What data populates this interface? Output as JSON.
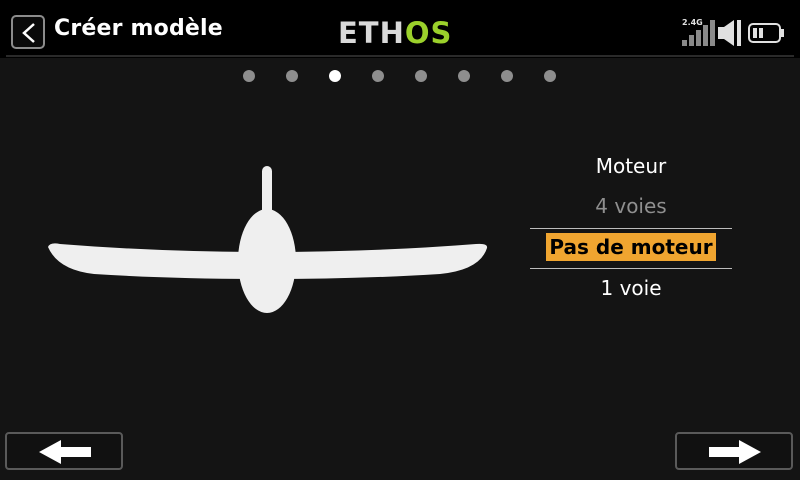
{
  "header": {
    "title": "Créer modèle",
    "logo": {
      "part1": "ETH",
      "part2": "OS",
      "color_part1": "#d9d9d9",
      "color_part2": "#9bd12b"
    },
    "status": {
      "signal_label": "2.4G"
    }
  },
  "pager": {
    "count": 8,
    "active_index": 2
  },
  "model_type": {
    "icon": "airplane-glider"
  },
  "motor_options": {
    "heading": "Moteur",
    "items": [
      {
        "label": "4 voies",
        "state": "dimmed"
      },
      {
        "label": "Pas de moteur",
        "state": "selected"
      },
      {
        "label": "1 voie",
        "state": "normal"
      }
    ],
    "highlight_color": "#f0a530"
  },
  "footer": {
    "prev_icon": "arrow-left-icon",
    "next_icon": "arrow-right-icon"
  }
}
